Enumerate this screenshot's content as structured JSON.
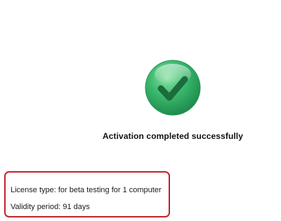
{
  "icons": {
    "success": "checkmark-icon"
  },
  "colors": {
    "success_green": "#2fb266",
    "highlight_border": "#c0222b"
  },
  "status": {
    "message": "Activation completed successfully"
  },
  "license": {
    "type_text": "License type: for beta testing for 1 computer",
    "validity_text": "Validity period: 91 days"
  }
}
